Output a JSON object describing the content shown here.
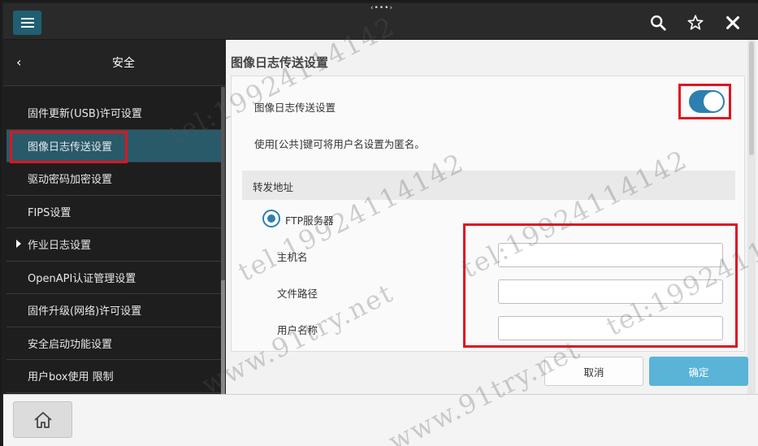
{
  "sidebar": {
    "title": "安全",
    "back_glyph": "‹",
    "items": [
      {
        "label": "固件更新(USB)许可设置",
        "active": false,
        "caret": false
      },
      {
        "label": "图像日志传送设置",
        "active": true,
        "caret": false
      },
      {
        "label": "驱动密码加密设置",
        "active": false,
        "caret": false
      },
      {
        "label": "FIPS设置",
        "active": false,
        "caret": false
      },
      {
        "label": "作业日志设置",
        "active": false,
        "caret": true
      },
      {
        "label": "OpenAPI认证管理设置",
        "active": false,
        "caret": false
      },
      {
        "label": "固件升级(网络)许可设置",
        "active": false,
        "caret": false
      },
      {
        "label": "安全启动功能设置",
        "active": false,
        "caret": false
      },
      {
        "label": "用户box使用 限制",
        "active": false,
        "caret": false
      }
    ]
  },
  "main": {
    "title": "图像日志传送设置",
    "setting_label": "图像日志传送设置",
    "toggle_on": true,
    "hint": "使用[公共]键可将用户名设置为匿名。",
    "section_title": "转发地址",
    "radio_label": "FTP服务器",
    "fields": [
      {
        "label": "主机名",
        "value": ""
      },
      {
        "label": "文件路径",
        "value": ""
      },
      {
        "label": "用户名称",
        "value": ""
      }
    ],
    "cancel_label": "取消",
    "ok_label": "确定"
  },
  "topbar": {
    "handle_glyph": "‹•••›"
  },
  "watermark": {
    "phone": "tel:19924114142",
    "site": "www.91try.net"
  },
  "colors": {
    "accent": "#2d7fb0",
    "sidebar_active": "#285a6a",
    "ok_button": "#5ab4d8",
    "annotation_red": "#e0141e"
  },
  "icons": {
    "menu": "hamburger-icon",
    "search": "search-icon",
    "favorite": "star-icon",
    "close": "close-icon",
    "home": "home-icon"
  }
}
